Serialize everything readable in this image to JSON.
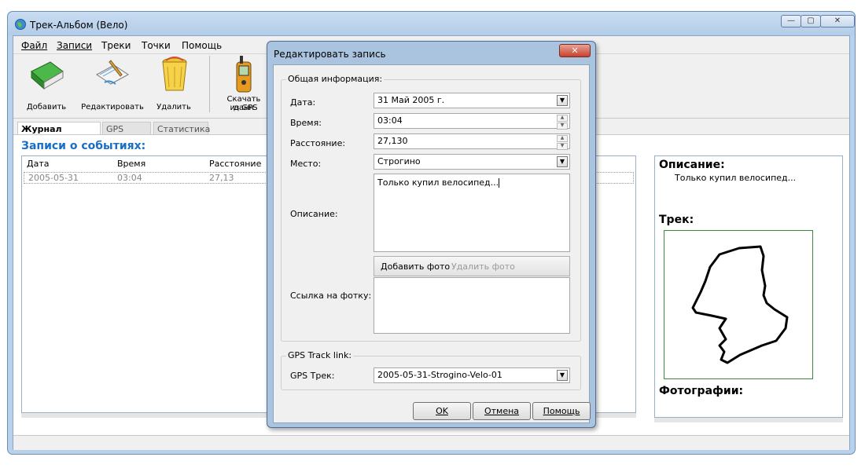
{
  "window": {
    "title": "Трек-Альбом  (Вело)",
    "minimize": "—",
    "maximize": "▢",
    "close": "✕"
  },
  "menu": [
    "Файл",
    "Записи",
    "Треки",
    "Точки",
    "Помощь"
  ],
  "toolbar": {
    "add": "Добавить",
    "edit": "Редактировать",
    "delete": "Удалить",
    "download_line1": "Скачать данн",
    "download_line2": "из GPS"
  },
  "tabs": [
    "Журнал записей",
    "GPS треки",
    "Статистика"
  ],
  "records": {
    "heading": "Записи о событиях:",
    "columns": [
      "Дата",
      "Время",
      "Расстояние"
    ],
    "rows": [
      {
        "date": "2005-05-31",
        "time": "03:04",
        "distance": "27,13"
      }
    ]
  },
  "details": {
    "description_heading": "Описание:",
    "description_text": "Только купил велосипед...",
    "track_heading": "Трек:",
    "photos_heading": "Фотографии:"
  },
  "dialog": {
    "title": "Редактировать запись",
    "close": "✕",
    "general_group": "Общая информация:",
    "date_label": "Дата:",
    "date_value": "31 Май 2005 г.",
    "time_label": "Время:",
    "time_value": "03:04",
    "distance_label": "Расстояние:",
    "distance_value": "27,130",
    "place_label": "Место:",
    "place_value": "Строгино",
    "description_label": "Описание:",
    "description_value": "Только купил велосипед...",
    "add_photo": "Добавить фото",
    "delete_photo": "Удалить фото",
    "photo_link_label": "Ссылка на фотку:",
    "gps_group": "GPS Track link:",
    "gps_track_label": "GPS Трек:",
    "gps_track_value": "2005-05-31-Strogino-Velo-01",
    "ok": "OK",
    "cancel": "Отмена",
    "help": "Помощь"
  },
  "colors": {
    "accent": "#1a6fc4",
    "title_bar": "#b9d1ea",
    "close_button": "#c7412d",
    "track_border": "#3a8a3a"
  }
}
